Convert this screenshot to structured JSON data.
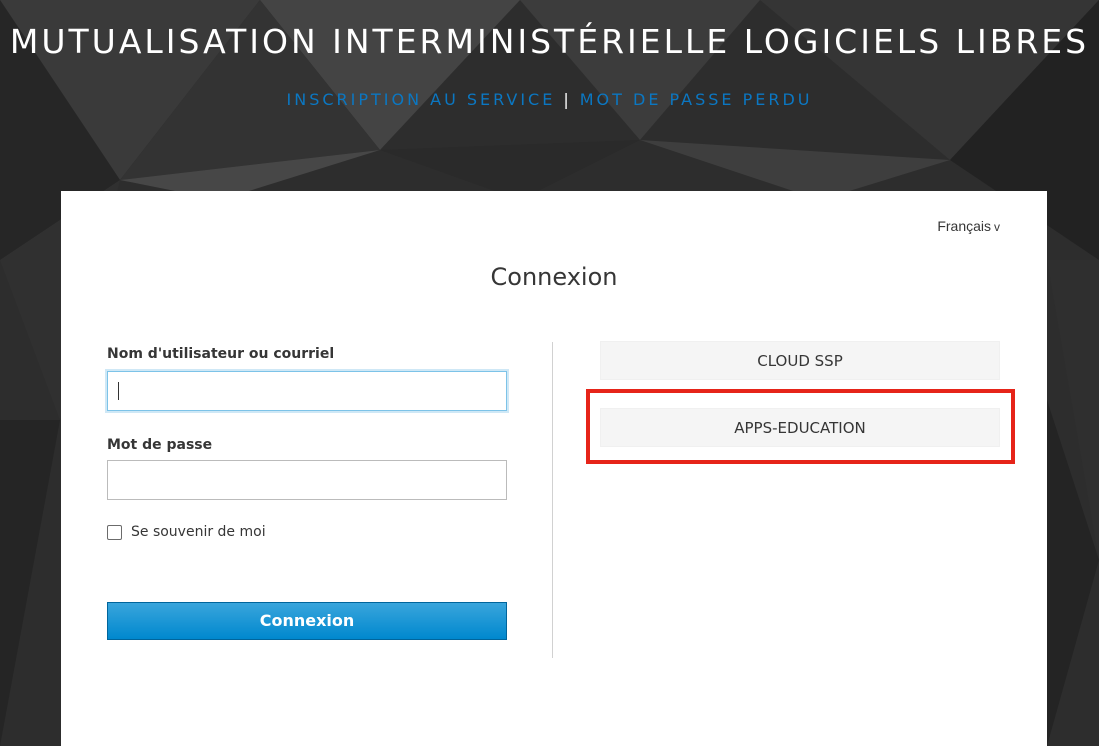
{
  "header": {
    "title": "MUTUALISATION INTERMINISTÉRIELLE LOGICIELS LIBRES",
    "register_link": "INSCRIPTION AU SERVICE",
    "separator": "|",
    "forgot_password_link": "MOT DE PASSE PERDU"
  },
  "card": {
    "language": "Français",
    "language_caret": "v",
    "title": "Connexion",
    "username_label": "Nom d'utilisateur ou courriel",
    "username_value": "",
    "password_label": "Mot de passe",
    "password_value": "",
    "remember_label": "Se souvenir de moi",
    "remember_checked": false,
    "submit_label": "Connexion"
  },
  "providers": [
    {
      "label": "CLOUD SSP"
    },
    {
      "label": "APPS-EDUCATION"
    }
  ],
  "colors": {
    "background": "#2b2b2b",
    "link": "#0b77c2",
    "primary_button": "#0088ce",
    "highlight": "#e62419"
  }
}
